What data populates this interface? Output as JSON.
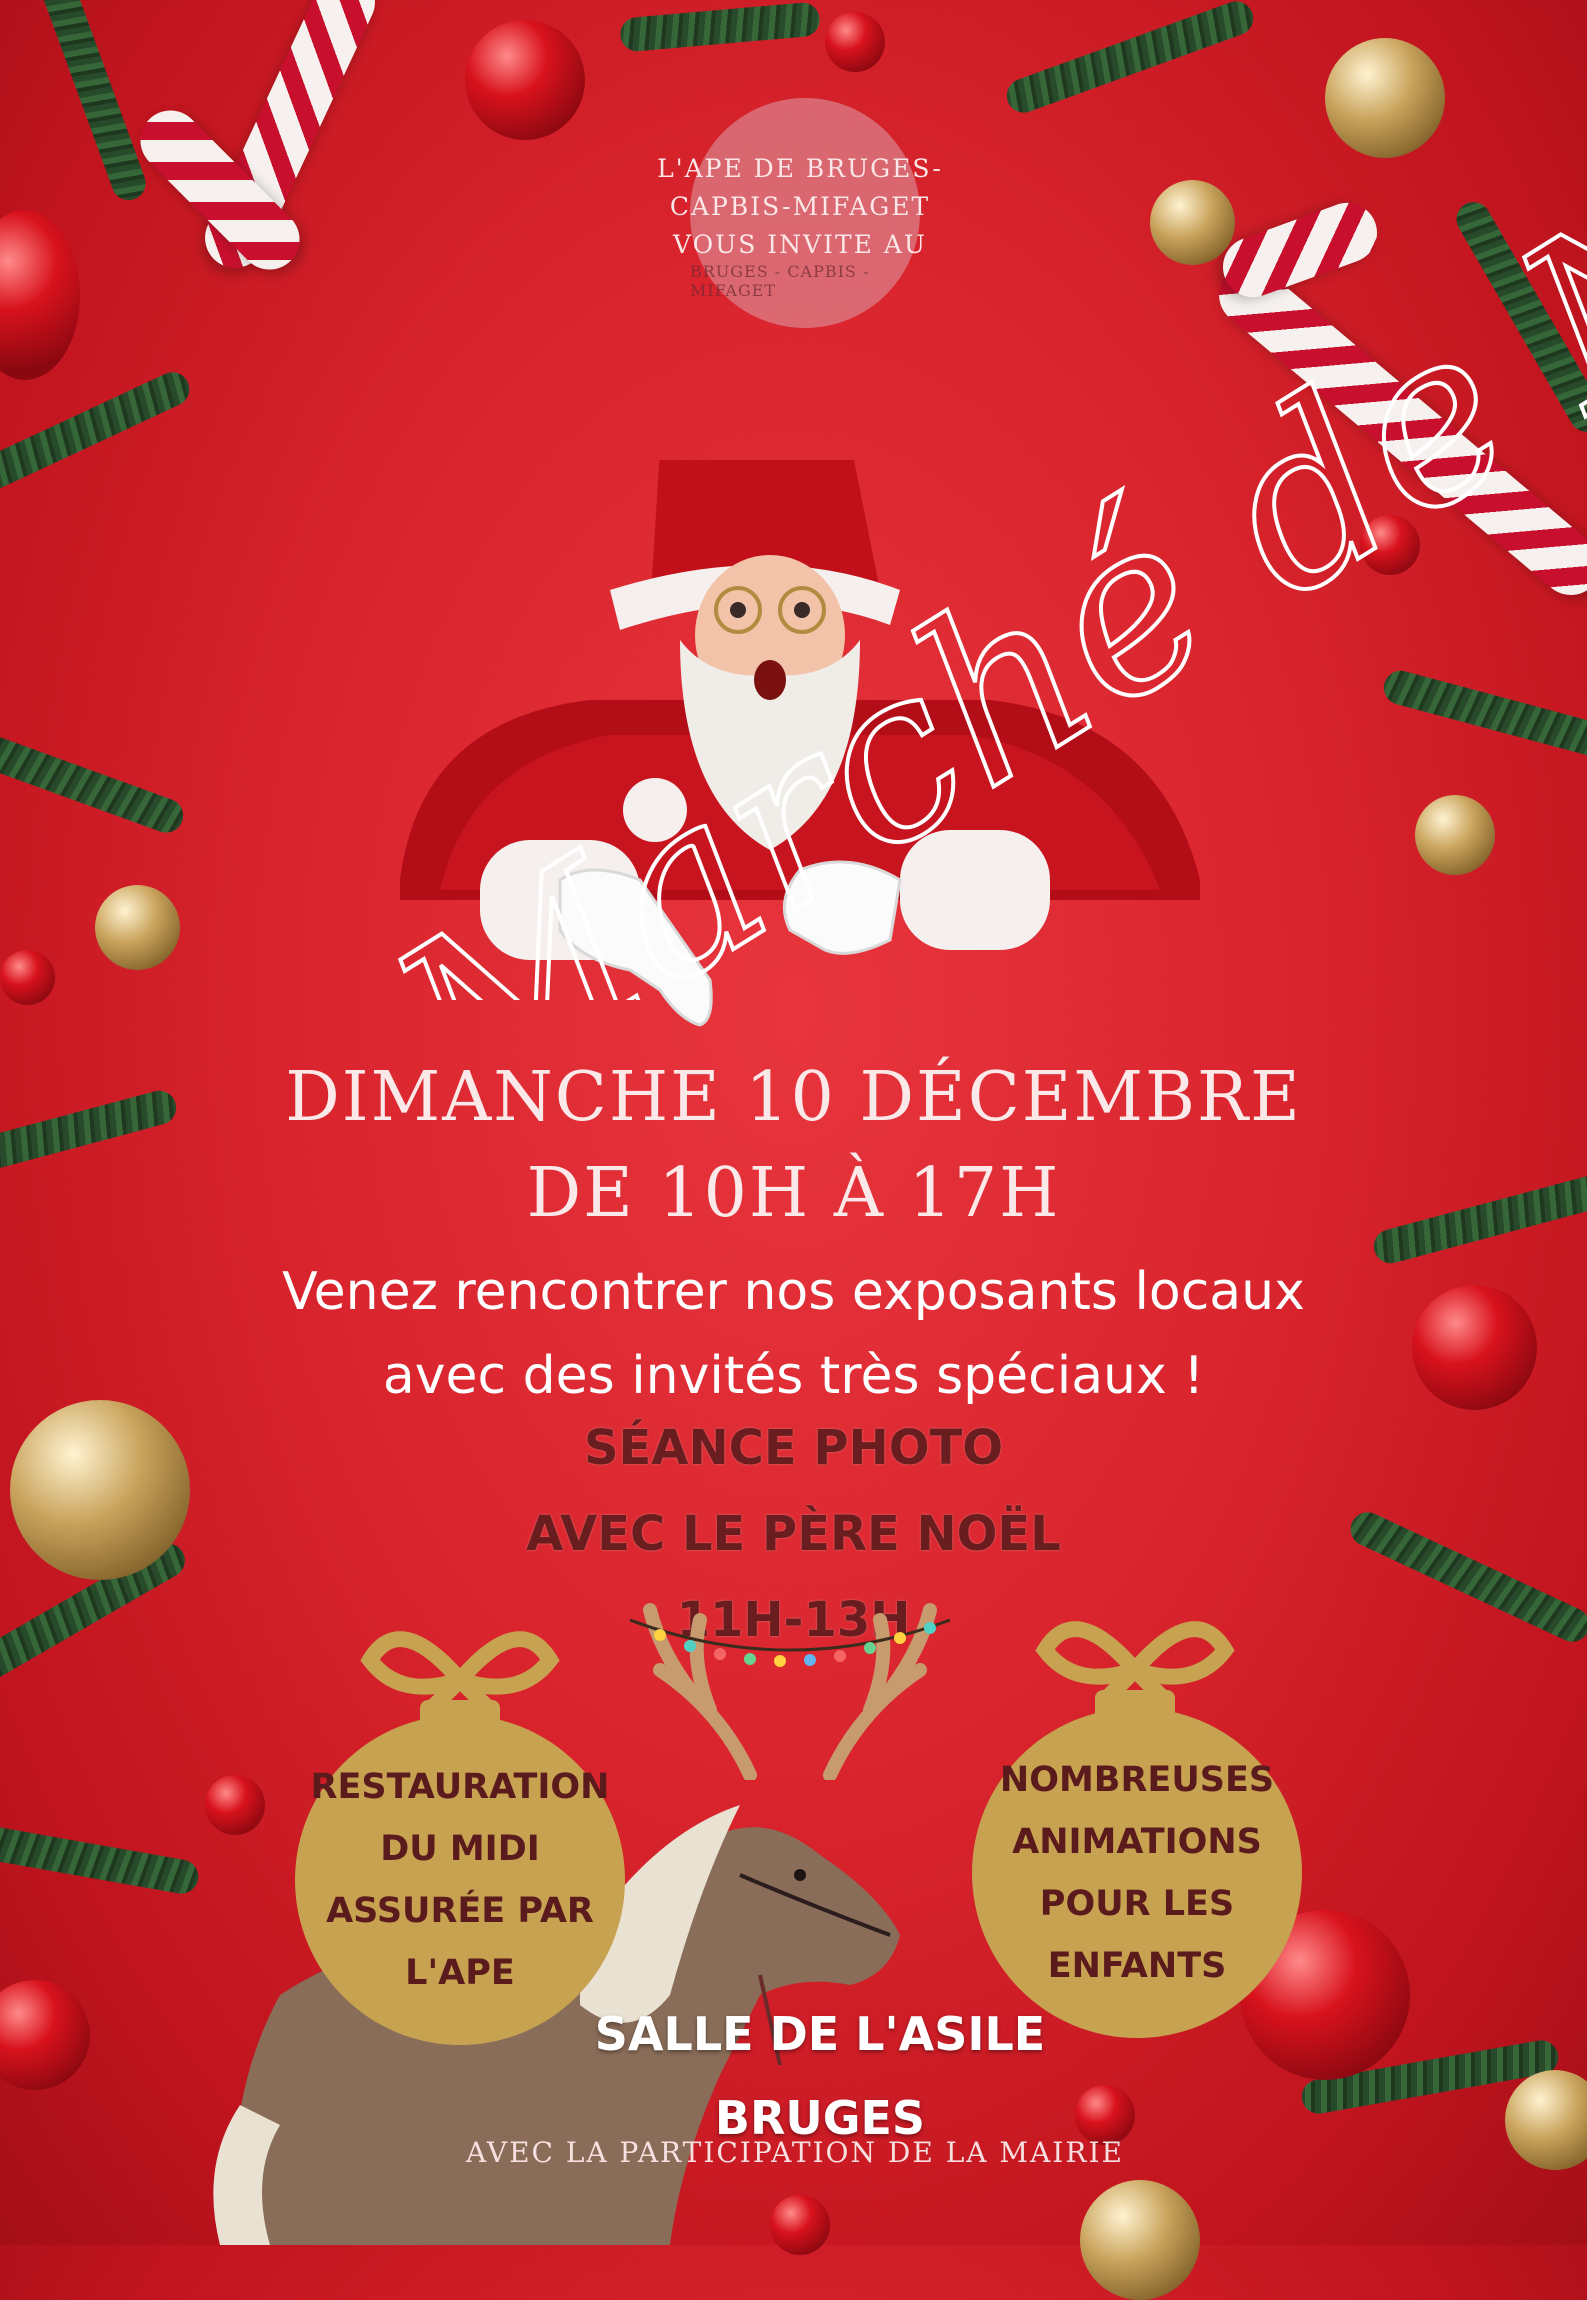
{
  "poster": {
    "intro_lines": [
      "L'APE DE BRUGES-",
      "CAPBIS-MIFAGET",
      "VOUS INVITE AU"
    ],
    "title": "Marché de Noël",
    "date_line1": "DIMANCHE 10 DÉCEMBRE",
    "date_line2": "DE 10H À 17H",
    "invite_line1": "Venez rencontrer nos exposants locaux",
    "invite_line2": "avec des invités très spéciaux !",
    "photo_line1": "SÉANCE PHOTO",
    "photo_line2": "AVEC LE PÈRE NOËL",
    "photo_time": "11H-13H",
    "left_ornament_lines": [
      "RESTAURATION",
      "DU MIDI",
      "ASSURÉE PAR",
      "L'APE"
    ],
    "right_ornament_lines": [
      "NOMBREUSES",
      "ANIMATIONS",
      "POUR LES",
      "ENFANTS"
    ],
    "venue_line1": "SALLE DE L'ASILE",
    "venue_line2": "BRUGES",
    "credit": "AVEC LA PARTICIPATION DE LA MAIRIE",
    "logo_text": "BRUGES - CAPBIS - MIFAGET"
  },
  "colors": {
    "background": "#d9242d",
    "ornament_gold": "#c6a251",
    "dark_text": "#6a1d1f"
  }
}
